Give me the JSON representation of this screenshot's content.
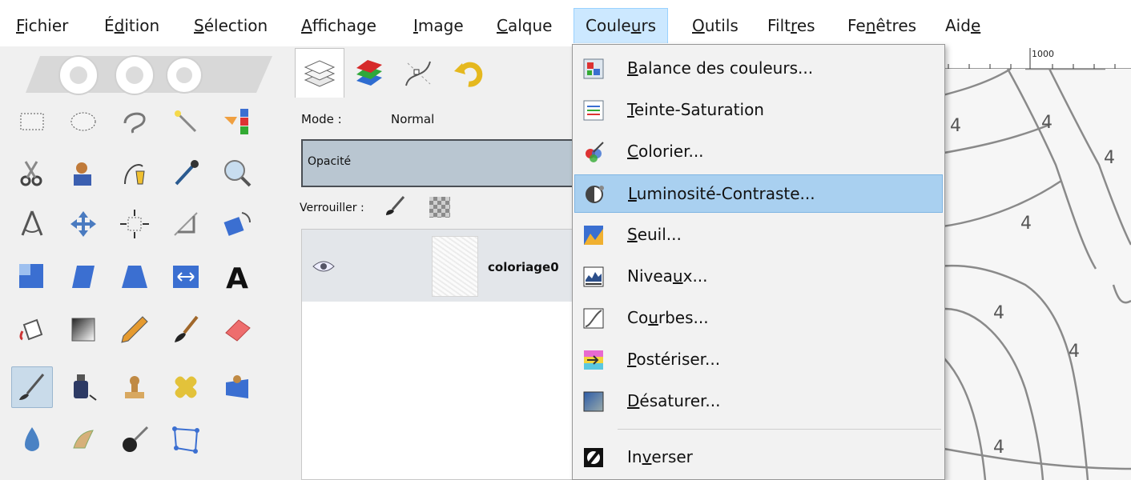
{
  "menubar": {
    "items": [
      {
        "label": "Fichier",
        "key": "fichier"
      },
      {
        "label": "Édition",
        "key": "edition"
      },
      {
        "label": "Sélection",
        "key": "selection"
      },
      {
        "label": "Affichage",
        "key": "affichage"
      },
      {
        "label": "Image",
        "key": "image"
      },
      {
        "label": "Calque",
        "key": "calque"
      },
      {
        "label": "Couleurs",
        "key": "couleurs",
        "active": true
      },
      {
        "label": "Outils",
        "key": "outils"
      },
      {
        "label": "Filtres",
        "key": "filtres"
      },
      {
        "label": "Fenêtres",
        "key": "fenetres"
      },
      {
        "label": "Aide",
        "key": "aide"
      }
    ]
  },
  "toolbox": {
    "selected_tool": "smudge-tool",
    "tools": [
      "rect-select",
      "ellipse-select",
      "free-select",
      "fuzzy-select",
      "select-by-color",
      "scissors-select",
      "foreground-select",
      "paths",
      "color-picker",
      "zoom",
      "measure",
      "move",
      "align",
      "crop",
      "rotate",
      "scale",
      "shear",
      "perspective",
      "flip",
      "text",
      "bucket-fill",
      "blend",
      "pencil",
      "paintbrush",
      "eraser",
      "airbrush",
      "ink",
      "clone",
      "heal",
      "perspective-clone",
      "blur-sharpen",
      "smudge",
      "dodge-burn",
      "cage-transform"
    ]
  },
  "layers_panel": {
    "tabs": [
      "layers-tab",
      "channels-tab",
      "paths-tab",
      "undo-history-tab"
    ],
    "mode_label": "Mode :",
    "mode_value": "Normal",
    "opacity_label": "Opacité",
    "lock_label": "Verrouiller :",
    "layer": {
      "name": "coloriage0",
      "visible": true
    }
  },
  "canvas": {
    "ruler_label": "1000",
    "region_number": "4"
  },
  "colors_menu": {
    "highlighted": "luminosite-contraste",
    "items": [
      {
        "key": "balance-couleurs",
        "pre": "",
        "mnemonic": "B",
        "post": "alance des couleurs...",
        "icon": "color-balance-icon"
      },
      {
        "key": "teinte-saturation",
        "pre": "",
        "mnemonic": "T",
        "post": "einte-Saturation",
        "icon": "hue-saturation-icon"
      },
      {
        "key": "colorier",
        "pre": "",
        "mnemonic": "C",
        "post": "olorier...",
        "icon": "colorize-icon"
      },
      {
        "key": "luminosite-contraste",
        "pre": "",
        "mnemonic": "L",
        "post": "uminosité-Contraste...",
        "icon": "brightness-contrast-icon"
      },
      {
        "key": "seuil",
        "pre": "",
        "mnemonic": "S",
        "post": "euil...",
        "icon": "threshold-icon"
      },
      {
        "key": "niveaux",
        "pre": "Nivea",
        "mnemonic": "u",
        "post": "x...",
        "icon": "levels-icon"
      },
      {
        "key": "courbes",
        "pre": "Co",
        "mnemonic": "u",
        "post": "rbes...",
        "icon": "curves-icon"
      },
      {
        "key": "posteriser",
        "pre": "",
        "mnemonic": "P",
        "post": "ostériser...",
        "icon": "posterize-icon"
      },
      {
        "key": "desaturer",
        "pre": "",
        "mnemonic": "D",
        "post": "ésaturer...",
        "icon": "desaturate-icon"
      },
      {
        "key": "inverser",
        "pre": "In",
        "mnemonic": "v",
        "post": "erser",
        "icon": "invert-icon"
      }
    ]
  },
  "colors": {
    "menu_highlight": "#a9d0f0",
    "menubar_active": "#cce8ff",
    "opacity_bar": "#b9c6d1",
    "selected_tool": "#c9dbea"
  }
}
